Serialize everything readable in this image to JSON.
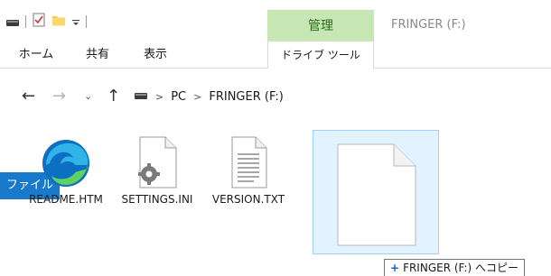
{
  "titlebar": {
    "context_tab": "管理",
    "title": "FRINGER (F:)"
  },
  "ribbon": {
    "file_tab": "ファイル",
    "tabs": [
      "ホーム",
      "共有",
      "表示"
    ],
    "context_tool_tab": "ドライブ ツール"
  },
  "address": {
    "path": [
      "PC",
      "FRINGER (F:)"
    ]
  },
  "files": [
    {
      "name": "README.HTM",
      "icon": "edge-icon"
    },
    {
      "name": "SETTINGS.INI",
      "icon": "settings-file-icon"
    },
    {
      "name": "VERSION.TXT",
      "icon": "text-file-icon"
    }
  ],
  "drag": {
    "tooltip": "FRINGER (F:) へコピー",
    "operation_icon": "plus-icon"
  },
  "colors": {
    "file_tab": "#1979ca",
    "context_tab": "#c6e7b4",
    "selection": "#cce8ff"
  }
}
